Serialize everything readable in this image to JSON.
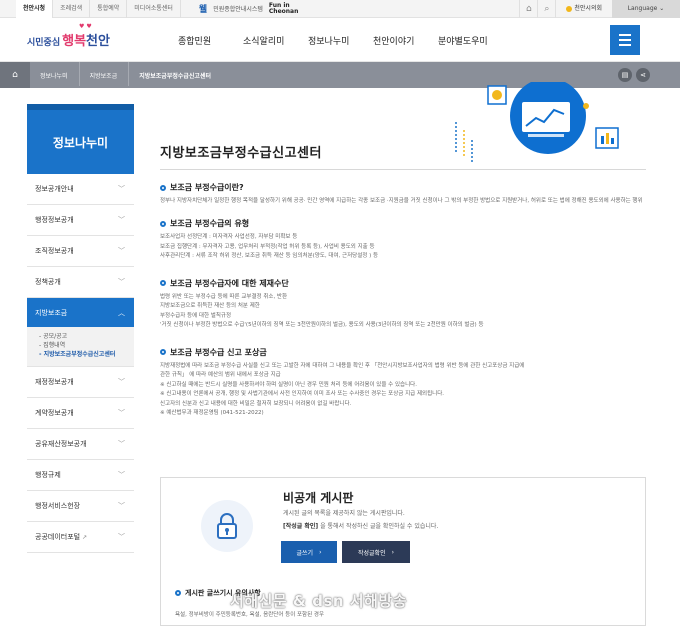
{
  "util": {
    "links": [
      "천안시청",
      "조례검색",
      "통합예약",
      "미디어소통센터"
    ],
    "brand_ulgok": "웰",
    "brand_sub": "민원종합안내시스템",
    "brand_fun_1": "Fun in",
    "brand_fun_2": "Cheonan",
    "mayor": "천안시의회",
    "lang": "Language"
  },
  "header": {
    "logo_pre": "시민중심",
    "logo_main_1": "행복",
    "logo_main_2": "천안",
    "gnb": [
      "종합민원",
      "소식알리미",
      "정보나누미",
      "천안이야기",
      "분야별도우미"
    ]
  },
  "breadcrumb": [
    "정보나누미",
    "지방보조금",
    "지방보조금부정수급신고센터"
  ],
  "sidebar": {
    "title": "정보나누미",
    "items_top": [
      "정보공개안내",
      "행정정보공개",
      "조직정보공개",
      "정책공개"
    ],
    "active": "지방보조금",
    "sub": [
      "공모/공고",
      "집행내역",
      "지방보조금부정수급신고센터"
    ],
    "items_bottom": [
      "재정정보공개",
      "계약정보공개",
      "공유재산정보공개",
      "행정규제",
      "행정서비스헌장",
      "공공데이터포털"
    ]
  },
  "content": {
    "title": "지방보조금부정수급신고센터",
    "s1_title": "보조금 부정수급이란?",
    "s1_text": "정부나 지방자치단체가 일정한 행정 목적을 달성하기 위해 공공· 민간 영역에 지급하는 각종 보조금 ·지원금을 거짓 신청이나 그 밖의 부정한 방법으로 지원받거나, 허위로 또는 법에 정해진 용도외에 사용하는 행위",
    "s2_title": "보조금 부정수급의 유형",
    "s2_lines": [
      "보조사업자 선정단계 : 미자격자 사업선정, 자부담 미확보 등",
      "보조금 집행단계 : 무자격자 고용, 업무처리 부적정(작업 허위 등록 등), 사업비 용도외 지출 등",
      "사후관리단계 : 서류 조작 허위 정산, 보조금 취득 재산 등 임의처분(양도, 대여, 근저당설정 ) 등"
    ],
    "s3_title": "보조금 부정수급자에 대한 제재수단",
    "s3_lines": [
      "법령 위반 또는 부정수급 등에 따른 교부결정 취소, 반환",
      "지방보조금으로 취득한 재산 등의 처분 제한",
      "부정수급자 등에 대한 벌칙규정",
      "'거짓 신청이나 부정한 방법으로 수급'(5년이하의 징역 또는 3천만원이하의 벌금), 용도외 사용(3년이하의 징역 또는 2천만원 이하의 벌금) 등"
    ],
    "s4_title": "보조금 부정수급 신고 포상금",
    "s4_lines": [
      "지방재정법에 따라 보조금 부정수급 사실을 신고 또는 고발한 자에 대하여 그 내용을 확인 후 「천안시지방보조사업자의 법령 위반 등에 관한 신고포상금 지급에",
      "관한 규칙」 에 따라 예산의 범위 내에서 포상금 지급",
      "※ 신고하실 때에는 반드시 실명을 사용하셔야 하며 실명이 아닌 경우 민원 처리 등에 어려움이 있을 수 있습니다.",
      "※ 신고내용이 언론에서 공개, 행정 및 사법기관에서 사전 인지하여 이미 조사 또는 수사중인 경우는 포상금 지급 제외됩니다.",
      "신고자의 신분과 신고 내용에 대한 비밀은 철저히 보장되니 어려움이 없길 바랍니다.",
      "※ 예산법무과 재정운영팀 (041-521-2022)"
    ],
    "board": {
      "title": "비공개 게시판",
      "desc": "게시된 글의 목록을 제공하지 않는 게시판입니다.",
      "desc2_bold": "[작성글 확인]",
      "desc2_rest": " 을 통해서 작성하신 글을 확인하실 수 있습니다.",
      "btn_write": "글쓰기",
      "btn_check": "작성글확인",
      "note_title": "게시판 글쓰기시 유의사항",
      "note_text": "욕설, 정부비방이 주민등록번호, 욕설, 음란단어 등이 포함된 경우"
    }
  },
  "watermark": "서해신문 & dsn 서해방송"
}
